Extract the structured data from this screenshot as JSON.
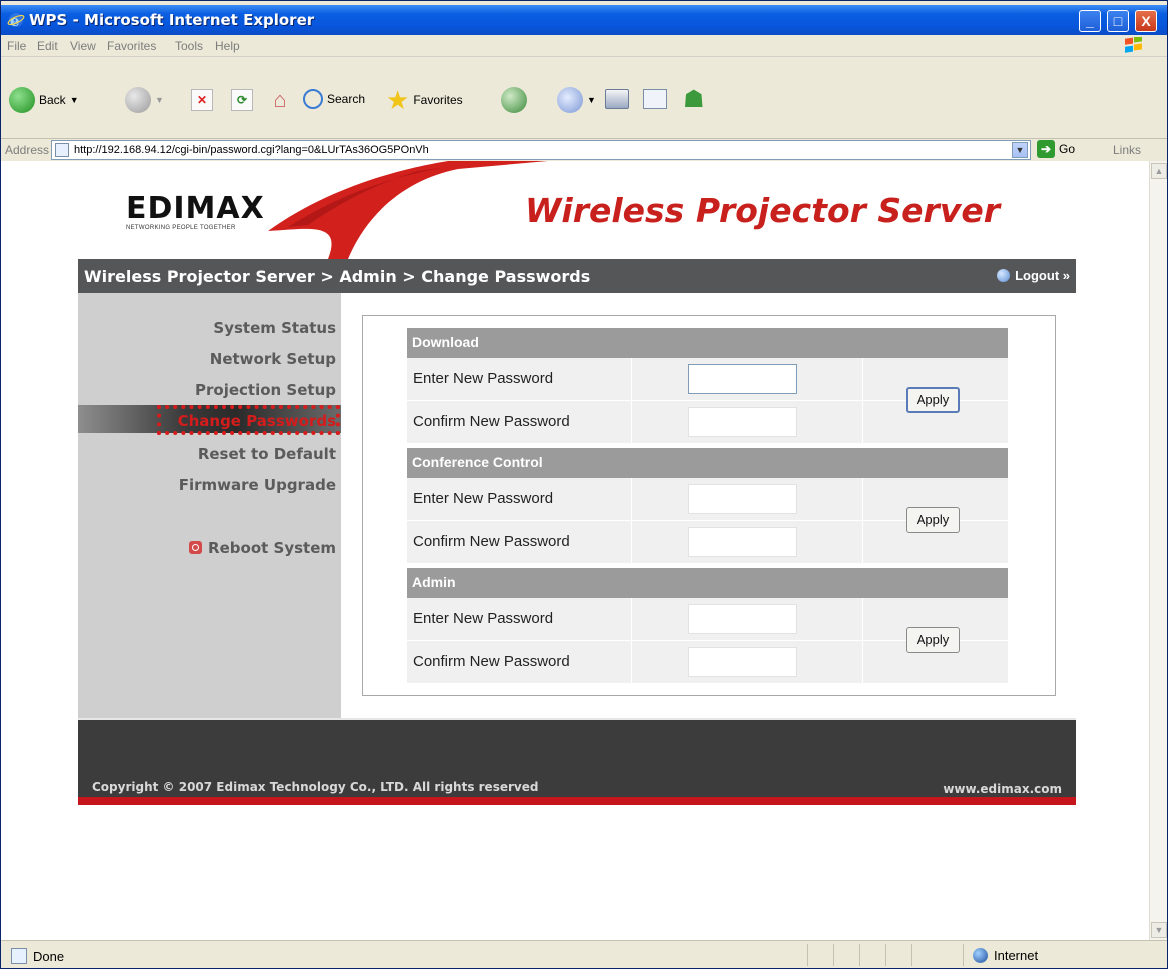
{
  "window": {
    "title": "WPS - Microsoft Internet Explorer",
    "min_label": "_",
    "max_label": "□",
    "close_label": "X"
  },
  "menu": [
    "File",
    "Edit",
    "View",
    "Favorites",
    "Tools",
    "Help"
  ],
  "toolbar": {
    "back_label": "Back",
    "search_label": "Search",
    "favorites_label": "Favorites"
  },
  "address": {
    "label": "Address",
    "url": "http://192.168.94.12/cgi-bin/password.cgi?lang=0&LUrTAs36OG5POnVh",
    "go_label": "Go",
    "links_label": "Links"
  },
  "header": {
    "logo": "EDIMAX",
    "logo_tagline": "NETWORKING PEOPLE TOGETHER",
    "product_title": "Wireless Projector Server"
  },
  "nav": {
    "breadcrumb": "Wireless Projector Server > Admin > Change Passwords",
    "logout_label": "Logout »"
  },
  "sidebar": {
    "items": [
      {
        "label": "System Status"
      },
      {
        "label": "Network Setup"
      },
      {
        "label": "Projection Setup"
      },
      {
        "label": "Change Passwords",
        "active": true
      },
      {
        "label": "Reset to Default"
      },
      {
        "label": "Firmware Upgrade"
      }
    ],
    "reboot_label": "Reboot System"
  },
  "sections": [
    {
      "title": "Download",
      "enter_label": "Enter New Password",
      "confirm_label": "Confirm New Password",
      "apply_label": "Apply"
    },
    {
      "title": "Conference Control",
      "enter_label": "Enter New Password",
      "confirm_label": "Confirm New Password",
      "apply_label": "Apply"
    },
    {
      "title": "Admin",
      "enter_label": "Enter New Password",
      "confirm_label": "Confirm New Password",
      "apply_label": "Apply"
    }
  ],
  "footer": {
    "copyright": "Copyright © 2007 Edimax Technology Co., LTD. All rights reserved",
    "website": "www.edimax.com"
  },
  "status": {
    "text": "Done",
    "zone": "Internet"
  },
  "colors": {
    "brand_red": "#c8201c",
    "nav_gray": "#555658",
    "section_header": "#9b9b9b",
    "highlight": "#d81c1c"
  }
}
